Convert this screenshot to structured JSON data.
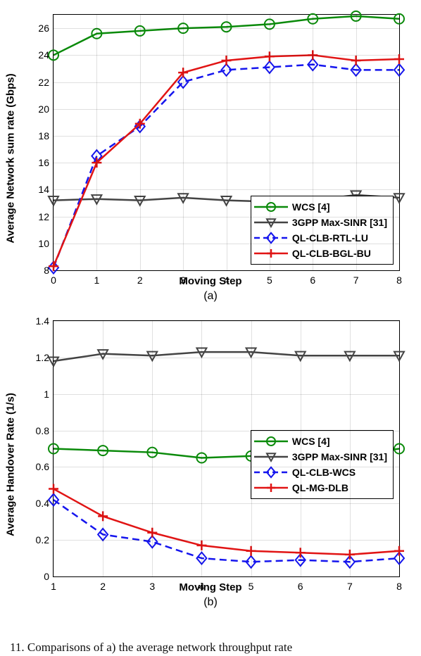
{
  "chart_data": [
    {
      "id": "a",
      "type": "line",
      "title": "",
      "subcaption": "(a)",
      "xlabel": "Moving Step",
      "ylabel": "Average Network sum rate (Gbps)",
      "xlim": [
        0,
        8
      ],
      "ylim": [
        8,
        27
      ],
      "xticks": [
        0,
        1,
        2,
        3,
        4,
        5,
        6,
        7,
        8
      ],
      "yticks": [
        8,
        10,
        12,
        14,
        16,
        18,
        20,
        22,
        24,
        26
      ],
      "legend_pos": "bottom-right",
      "x": [
        0,
        1,
        2,
        3,
        4,
        5,
        6,
        7,
        8
      ],
      "series": [
        {
          "name": "WCS [4]",
          "color": "#0a8a0a",
          "marker": "circle",
          "dash": "solid",
          "values": [
            24.0,
            25.6,
            25.8,
            26.0,
            26.1,
            26.3,
            26.7,
            26.9,
            26.7
          ]
        },
        {
          "name": "3GPP Max-SINR [31]",
          "color": "#444444",
          "marker": "triangle-down",
          "dash": "solid",
          "values": [
            13.2,
            13.3,
            13.2,
            13.4,
            13.2,
            13.1,
            13.2,
            13.6,
            13.4
          ]
        },
        {
          "name": "QL-CLB-RTL-LU",
          "color": "#1515ee",
          "marker": "diamond",
          "dash": "dashed",
          "values": [
            8.2,
            16.5,
            18.7,
            22.0,
            22.9,
            23.1,
            23.3,
            22.9,
            22.9
          ]
        },
        {
          "name": "QL-CLB-BGL-BU",
          "color": "#e11414",
          "marker": "plus",
          "dash": "solid",
          "values": [
            8.3,
            16.0,
            18.9,
            22.7,
            23.6,
            23.9,
            24.0,
            23.6,
            23.7
          ]
        }
      ]
    },
    {
      "id": "b",
      "type": "line",
      "title": "",
      "subcaption": "(b)",
      "xlabel": "Moving Step",
      "ylabel": "Average Handover Rate (1/s)",
      "xlim": [
        1,
        8
      ],
      "ylim": [
        0,
        1.4
      ],
      "xticks": [
        1,
        2,
        3,
        4,
        5,
        6,
        7,
        8
      ],
      "yticks": [
        0,
        0.2,
        0.4,
        0.6,
        0.8,
        1.0,
        1.2,
        1.4
      ],
      "legend_pos": "middle-right",
      "x": [
        1,
        2,
        3,
        4,
        5,
        6,
        7,
        8
      ],
      "series": [
        {
          "name": "WCS [4]",
          "color": "#0a8a0a",
          "marker": "circle",
          "dash": "solid",
          "values": [
            0.7,
            0.69,
            0.68,
            0.65,
            0.66,
            0.67,
            0.66,
            0.7
          ]
        },
        {
          "name": "3GPP Max-SINR [31]",
          "color": "#444444",
          "marker": "triangle-down",
          "dash": "solid",
          "values": [
            1.18,
            1.22,
            1.21,
            1.23,
            1.23,
            1.21,
            1.21,
            1.21
          ]
        },
        {
          "name": "QL-CLB-WCS",
          "color": "#1515ee",
          "marker": "diamond",
          "dash": "dashed",
          "values": [
            0.42,
            0.23,
            0.19,
            0.1,
            0.08,
            0.09,
            0.08,
            0.1
          ]
        },
        {
          "name": "QL-MG-DLB",
          "color": "#e11414",
          "marker": "plus",
          "dash": "solid",
          "values": [
            0.48,
            0.33,
            0.24,
            0.17,
            0.14,
            0.13,
            0.12,
            0.14
          ]
        }
      ]
    }
  ],
  "caption_fragment": "11.   Comparisons of a) the average network throughput rate"
}
